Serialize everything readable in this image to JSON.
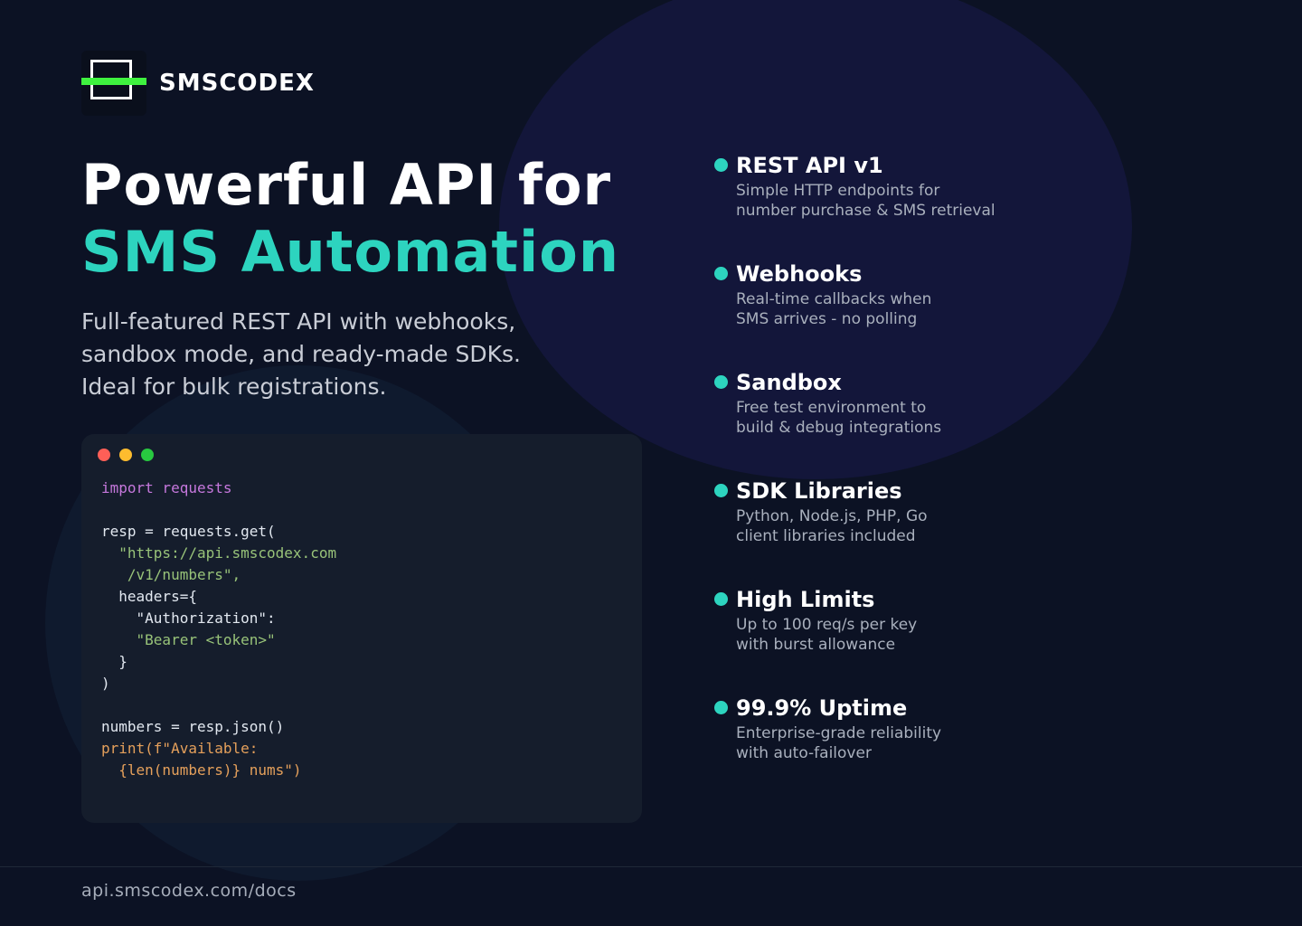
{
  "brand": {
    "name": "SMSCODEX",
    "icon": "logo-icon",
    "accent_color": "#3ff23f"
  },
  "hero": {
    "title_line1": "Powerful API for",
    "title_line2": "SMS Automation",
    "subtitle": "Full-featured REST API with webhooks, sandbox mode, and ready-made SDKs. Ideal for bulk registrations.",
    "accent_color": "#2dd4bf"
  },
  "code_window": {
    "lines": [
      [
        {
          "t": "import requests",
          "c": "kw"
        }
      ],
      [],
      [
        {
          "t": "resp = requests.get(",
          "c": ""
        }
      ],
      [
        {
          "t": "  \"https://api.smscodex.com",
          "c": "str"
        }
      ],
      [
        {
          "t": "   /v1/numbers\",",
          "c": "str"
        }
      ],
      [
        {
          "t": "  headers={",
          "c": ""
        }
      ],
      [
        {
          "t": "    \"Authorization\":",
          "c": ""
        }
      ],
      [
        {
          "t": "    \"Bearer <token>\"",
          "c": "str"
        }
      ],
      [
        {
          "t": "  }",
          "c": ""
        }
      ],
      [
        {
          "t": ")",
          "c": ""
        }
      ],
      [],
      [
        {
          "t": "numbers = resp.json()",
          "c": ""
        }
      ],
      [
        {
          "t": "print(f\"Available:",
          "c": "fn"
        }
      ],
      [
        {
          "t": "  {len(numbers)} nums\")",
          "c": "fn"
        }
      ]
    ]
  },
  "features": [
    {
      "title": "REST API v1",
      "line1": "Simple HTTP endpoints for",
      "line2": "number purchase & SMS retrieval"
    },
    {
      "title": "Webhooks",
      "line1": "Real-time callbacks when",
      "line2": "SMS arrives - no polling"
    },
    {
      "title": "Sandbox",
      "line1": "Free test environment to",
      "line2": "build & debug integrations"
    },
    {
      "title": "SDK Libraries",
      "line1": "Python, Node.js, PHP, Go",
      "line2": "client libraries included"
    },
    {
      "title": "High Limits",
      "line1": "Up to 100 req/s per key",
      "line2": "with burst allowance"
    },
    {
      "title": "99.9% Uptime",
      "line1": "Enterprise-grade reliability",
      "line2": "with auto-failover"
    }
  ],
  "footer": {
    "link": "api.smscodex.com/docs"
  }
}
